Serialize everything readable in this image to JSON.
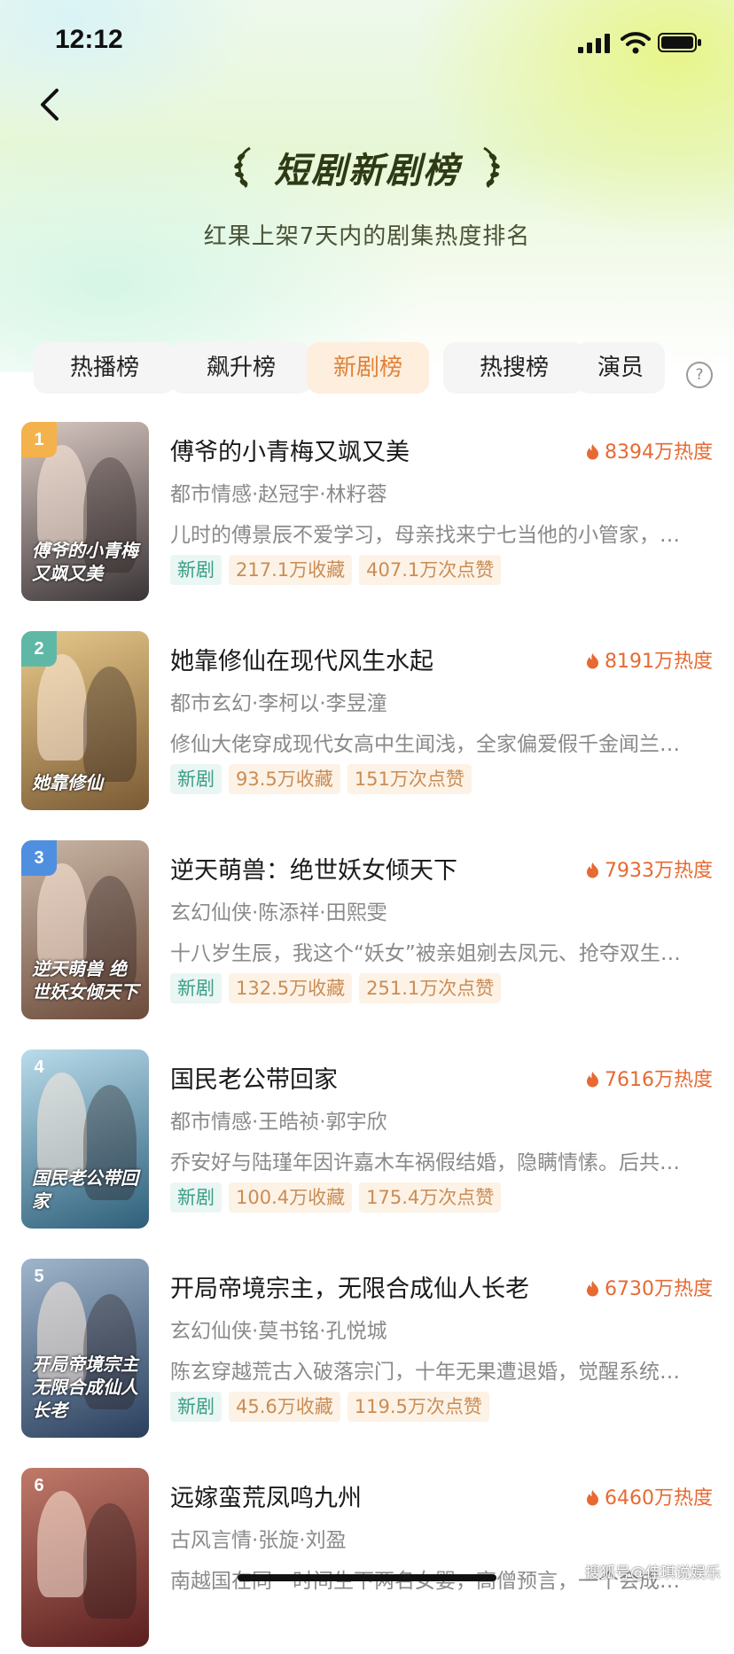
{
  "status_bar": {
    "time": "12:12"
  },
  "header": {
    "title": "短剧新剧榜",
    "subtitle": "红果上架7天内的剧集热度排名"
  },
  "tabs": [
    {
      "label": "热播榜",
      "active": false
    },
    {
      "label": "飙升榜",
      "active": false
    },
    {
      "label": "新剧榜",
      "active": true
    },
    {
      "label": "热搜榜",
      "active": false
    },
    {
      "label": "演员",
      "active": false
    }
  ],
  "help_label": "?",
  "items": [
    {
      "rank": "1",
      "rank_color": "#f3b24c",
      "title": "傅爷的小青梅又飒又美",
      "heat": "8394万热度",
      "genre": "都市情感·赵冠宇·林籽蓉",
      "desc": "儿时的傅景辰不爱学习，母亲找来宁七当他的小管家，…",
      "tags": [
        "新剧",
        "217.1万收藏",
        "407.1万次点赞"
      ],
      "cover_text": "傅爷的小青梅又飒又美",
      "cover_bg": [
        "#3a3436",
        "#d9c8c2"
      ]
    },
    {
      "rank": "2",
      "rank_color": "#5fb8a6",
      "title": "她靠修仙在现代风生水起",
      "heat": "8191万热度",
      "genre": "都市玄幻·李柯以·李昱潼",
      "desc": "修仙大佬穿成现代女高中生闻浅，全家偏爱假千金闻兰…",
      "tags": [
        "新剧",
        "93.5万收藏",
        "151万次点赞"
      ],
      "cover_text": "她靠修仙",
      "cover_bg": [
        "#7a5a34",
        "#e8c98a"
      ]
    },
    {
      "rank": "3",
      "rank_color": "#4f8fe0",
      "title": "逆天萌兽：绝世妖女倾天下",
      "heat": "7933万热度",
      "genre": "玄幻仙侠·陈添祥·田熙雯",
      "desc": "十八岁生辰，我这个“妖女”被亲姐剜去凤元、抢夺双生…",
      "tags": [
        "新剧",
        "132.5万收藏",
        "251.1万次点赞"
      ],
      "cover_text": "逆天萌兽 绝世妖女倾天下",
      "cover_bg": [
        "#6b4a3a",
        "#c9b6a6"
      ]
    },
    {
      "rank": "4",
      "rank_color": "rgba(0,0,0,0)",
      "title": "国民老公带回家",
      "heat": "7616万热度",
      "genre": "都市情感·王皓祯·郭宇欣",
      "desc": "乔安好与陆瑾年因许嘉木车祸假结婚，隐瞒情愫。后共…",
      "tags": [
        "新剧",
        "100.4万收藏",
        "175.4万次点赞"
      ],
      "cover_text": "国民老公带回家",
      "cover_bg": [
        "#2e5f7a",
        "#b9dceb"
      ]
    },
    {
      "rank": "5",
      "rank_color": "rgba(0,0,0,0)",
      "title": "开局帝境宗主，无限合成仙人长老",
      "heat": "6730万热度",
      "genre": "玄幻仙侠·莫书铭·孔悦城",
      "desc": "陈玄穿越荒古入破落宗门，十年无果遭退婚，觉醒系统…",
      "tags": [
        "新剧",
        "45.6万收藏",
        "119.5万次点赞"
      ],
      "cover_text": "开局帝境宗主 无限合成仙人长老",
      "cover_bg": [
        "#2a3f5c",
        "#9fb6cc"
      ]
    },
    {
      "rank": "6",
      "rank_color": "rgba(0,0,0,0)",
      "title": "远嫁蛮荒凤鸣九州",
      "heat": "6460万热度",
      "genre": "古风言情·张旋·刘盈",
      "desc": "南越国在同一时间生下两名女婴，高僧预言，一个会成…",
      "tags": [],
      "cover_text": "",
      "cover_bg": [
        "#5a1e1e",
        "#c07a6a"
      ]
    }
  ],
  "watermark": "搜狐号@佳琪说娱乐"
}
